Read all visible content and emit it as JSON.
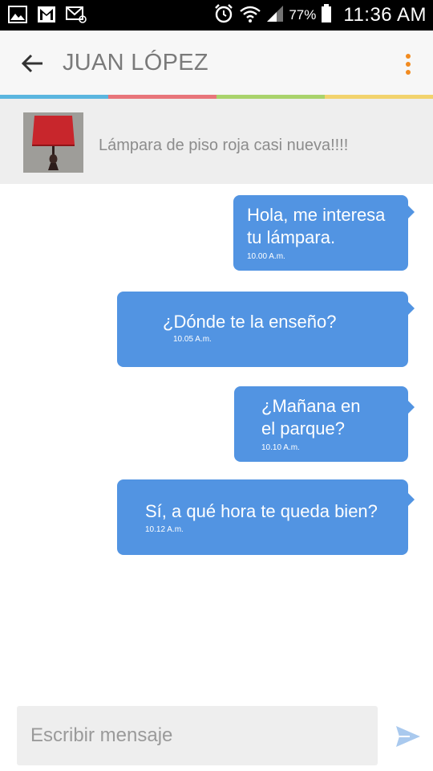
{
  "status_bar": {
    "icons": [
      "gallery-icon",
      "gmail-icon",
      "email-icon",
      "alarm-icon",
      "wifi-icon",
      "signal-icon",
      "battery-icon"
    ],
    "battery": "77%",
    "time": "11:36 AM"
  },
  "header": {
    "title": "JUAN LÓPEZ",
    "strip_colors": [
      "#5bb6df",
      "#e8757a",
      "#a9d36c",
      "#f2d36d"
    ],
    "menu_color": "#f28b20"
  },
  "product": {
    "title": "Lámpara de piso roja casi nueva!!!!",
    "lamp_shade_color": "#c8262c"
  },
  "messages": [
    {
      "lines": [
        "Hola, me interesa",
        "tu lámpara."
      ],
      "time": "10.00 A.m."
    },
    {
      "lines": [
        "¿Dónde te la enseño?"
      ],
      "time": "10.05 A.m."
    },
    {
      "lines": [
        "¿Mañana en",
        "el parque?"
      ],
      "time": "10.10 A.m."
    },
    {
      "lines": [
        "Sí, a qué hora te queda bien?"
      ],
      "time": "10.12 A.m."
    }
  ],
  "composer": {
    "placeholder": "Escribir mensaje",
    "value": ""
  },
  "colors": {
    "bubble": "#5294e2",
    "send_icon": "#a9c9ee"
  }
}
